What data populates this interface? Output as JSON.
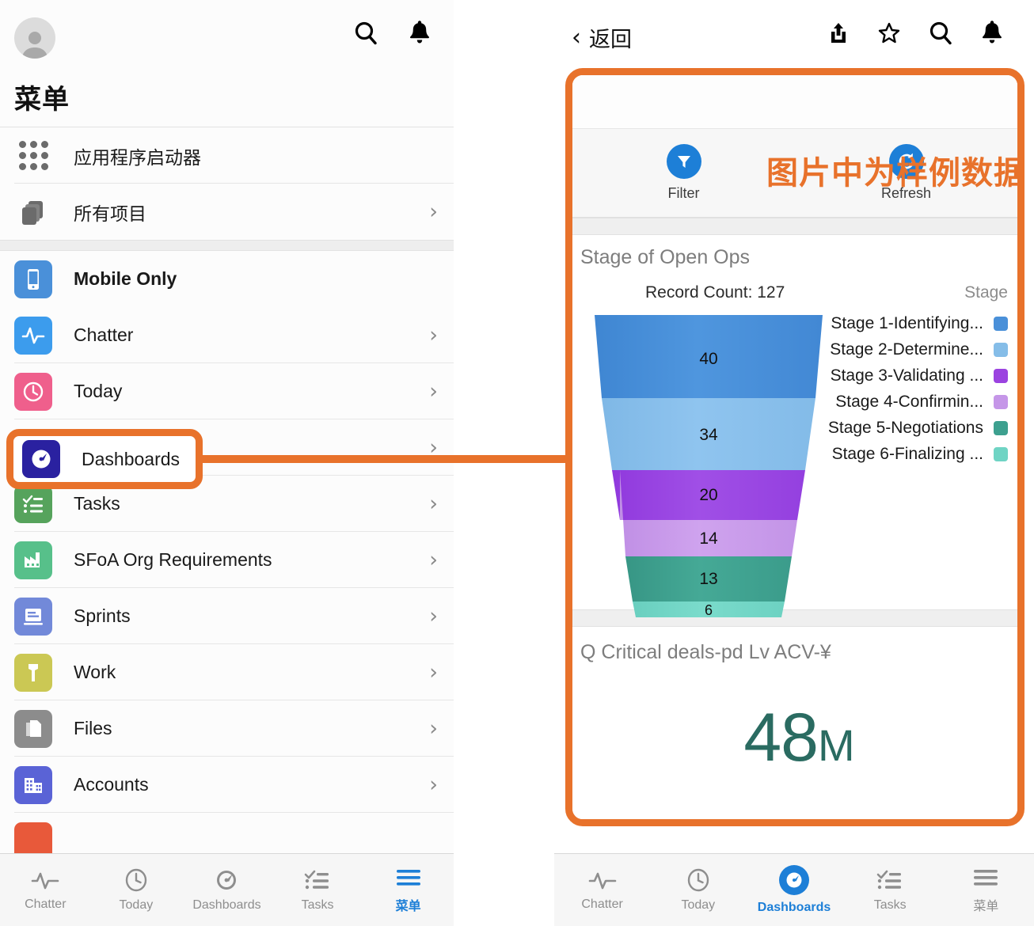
{
  "left": {
    "menu_title": "菜单",
    "topbar_icons": [
      "search-icon",
      "bell-icon"
    ],
    "items": [
      {
        "label": "应用程序启动器",
        "icon": "app-launcher-icon",
        "color": "#6b6b6b",
        "chevron": false,
        "bold": false
      },
      {
        "label": "所有项目",
        "icon": "all-items-icon",
        "color": "#6b6b6b",
        "chevron": true,
        "bold": false
      },
      {
        "label": "Mobile Only",
        "icon": "mobile-icon",
        "color": "#4a90d9",
        "chevron": false,
        "bold": true
      },
      {
        "label": "Chatter",
        "icon": "chatter-icon",
        "color": "#3c9ced",
        "chevron": true,
        "bold": false
      },
      {
        "label": "Today",
        "icon": "today-icon",
        "color": "#ef5f8c",
        "chevron": true,
        "bold": false
      },
      {
        "label": "Dashboards",
        "icon": "dashboards-icon",
        "color": "#2a21a0",
        "chevron": true,
        "bold": false
      },
      {
        "label": "Tasks",
        "icon": "tasks-icon",
        "color": "#56a35c",
        "chevron": true,
        "bold": false
      },
      {
        "label": "SFoA Org Requirements",
        "icon": "factory-icon",
        "color": "#57c08a",
        "chevron": true,
        "bold": false
      },
      {
        "label": "Sprints",
        "icon": "sprints-icon",
        "color": "#7289d9",
        "chevron": true,
        "bold": false
      },
      {
        "label": "Work",
        "icon": "hammer-icon",
        "color": "#cbc854",
        "chevron": true,
        "bold": false
      },
      {
        "label": "Files",
        "icon": "files-icon",
        "color": "#8c8c8c",
        "chevron": true,
        "bold": false
      },
      {
        "label": "Accounts",
        "icon": "accounts-icon",
        "color": "#5a63d6",
        "chevron": true,
        "bold": false
      }
    ],
    "tabs": [
      {
        "label": "Chatter",
        "icon": "chatter-icon",
        "active": false
      },
      {
        "label": "Today",
        "icon": "clock-icon",
        "active": false
      },
      {
        "label": "Dashboards",
        "icon": "gauge-icon",
        "active": false
      },
      {
        "label": "Tasks",
        "icon": "tasks-icon",
        "active": false
      },
      {
        "label": "菜单",
        "icon": "hamburger-icon",
        "active": true
      }
    ]
  },
  "right": {
    "back_label": "返回",
    "topbar_icons": [
      "share-icon",
      "star-icon",
      "search-icon",
      "bell-icon"
    ],
    "actions": [
      {
        "label": "Filter",
        "icon": "filter-icon"
      },
      {
        "label": "Refresh",
        "icon": "refresh-icon"
      }
    ],
    "sample_note": "图片中为样例数据",
    "metric": {
      "title": "Q Critical deals-pd Lv ACV-¥",
      "value": "48",
      "suffix": "M",
      "color": "#2a6b61"
    },
    "tabs": [
      {
        "label": "Chatter",
        "icon": "chatter-icon",
        "active": false
      },
      {
        "label": "Today",
        "icon": "clock-icon",
        "active": false
      },
      {
        "label": "Dashboards",
        "icon": "gauge-icon",
        "active": true
      },
      {
        "label": "Tasks",
        "icon": "tasks-icon",
        "active": false
      },
      {
        "label": "菜单",
        "icon": "hamburger-icon",
        "active": false
      }
    ]
  },
  "highlight": {
    "label": "Dashboards",
    "color": "#E8722B"
  },
  "chart_data": {
    "type": "funnel",
    "title": "Stage of Open Ops",
    "subtitle": "Record Count: 127",
    "record_count": 127,
    "legend_title": "Stage",
    "legend_position": "right",
    "categories": [
      "Stage 1-Identifying...",
      "Stage 2-Determine...",
      "Stage 3-Validating ...",
      "Stage 4-Confirmin...",
      "Stage 5-Negotiations",
      "Stage 6-Finalizing ..."
    ],
    "values": [
      40,
      34,
      20,
      14,
      13,
      6
    ],
    "colors": [
      "#4A90D9",
      "#85BDE8",
      "#9B43E0",
      "#C596E8",
      "#3DA08F",
      "#6FD4C4"
    ],
    "xlabel": "",
    "ylabel": "",
    "grid": false
  }
}
